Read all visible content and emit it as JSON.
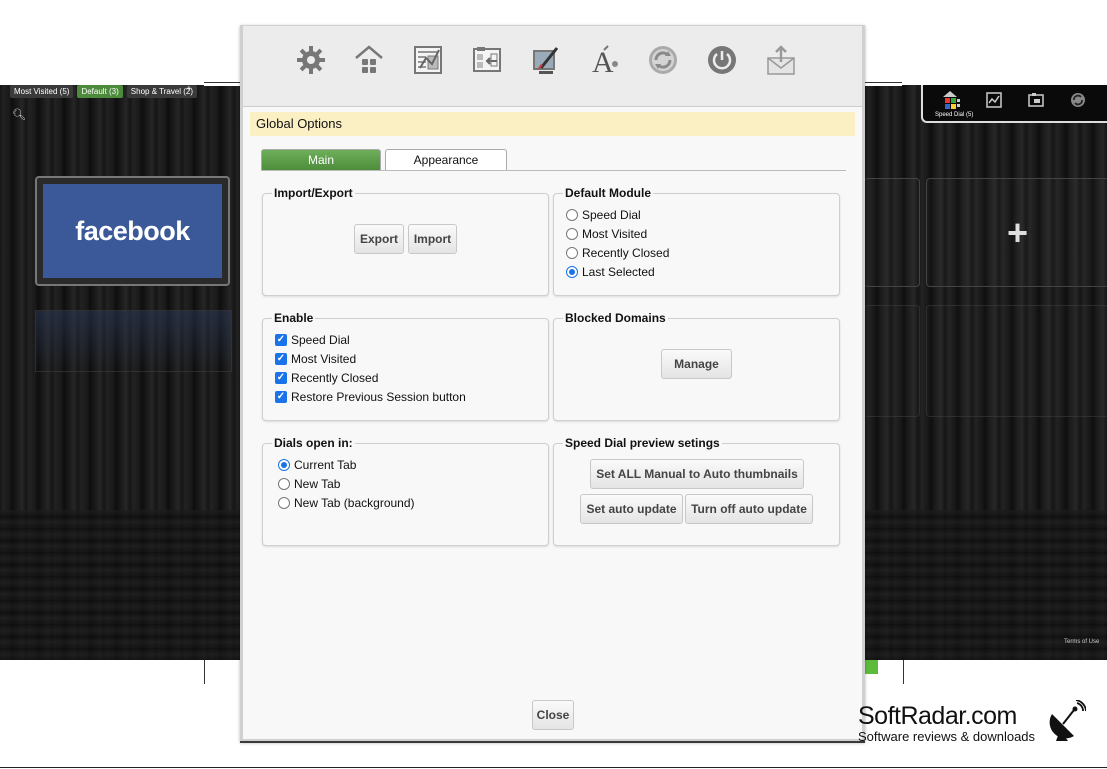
{
  "background": {
    "tabs": [
      "Most Visited (5)",
      "Default (3)",
      "Shop & Travel (2)"
    ],
    "active_tab": "Default (3)",
    "add_tab": "+",
    "tile_label": "facebook",
    "add_tile": "+",
    "mini_toolbar_label": "Speed Dial (5)",
    "footer_link": "Terms of Use"
  },
  "toolbar": {
    "icons": [
      "gear-icon",
      "home-icon",
      "dials-icon",
      "import-icon",
      "theme-icon",
      "font-icon",
      "refresh-icon",
      "power-icon",
      "share-icon"
    ]
  },
  "dialog": {
    "title": "Global Options",
    "tabs": [
      {
        "label": "Main",
        "active": true
      },
      {
        "label": "Appearance",
        "active": false
      }
    ],
    "import_export": {
      "legend": "Import/Export",
      "export_label": "Export",
      "import_label": "Import"
    },
    "default_module": {
      "legend": "Default Module",
      "options": [
        {
          "label": "Speed Dial",
          "selected": false
        },
        {
          "label": "Most Visited",
          "selected": false
        },
        {
          "label": "Recently Closed",
          "selected": false
        },
        {
          "label": "Last Selected",
          "selected": true
        }
      ]
    },
    "enable": {
      "legend": "Enable",
      "options": [
        {
          "label": "Speed Dial",
          "checked": true
        },
        {
          "label": "Most Visited",
          "checked": true
        },
        {
          "label": "Recently Closed",
          "checked": true
        },
        {
          "label": "Restore Previous Session button",
          "checked": true
        }
      ]
    },
    "blocked_domains": {
      "legend": "Blocked Domains",
      "manage_label": "Manage"
    },
    "dials_open_in": {
      "legend": "Dials open in:",
      "options": [
        {
          "label": "Current Tab",
          "selected": true
        },
        {
          "label": "New Tab",
          "selected": false
        },
        {
          "label": "New Tab (background)",
          "selected": false
        }
      ]
    },
    "preview": {
      "legend": "Speed Dial preview setings",
      "set_all_label": "Set ALL Manual to Auto thumbnails",
      "auto_update_label": "Set auto update",
      "turn_off_label": "Turn off auto update"
    },
    "close_label": "Close"
  },
  "watermark": {
    "title": "SoftRadar.com",
    "subtitle": "Software reviews & downloads"
  },
  "colors": {
    "accent_green": "#4d8d3b",
    "title_bar": "#fbefc4",
    "facebook_blue": "#3b5998",
    "control_blue": "#1a73e8"
  }
}
